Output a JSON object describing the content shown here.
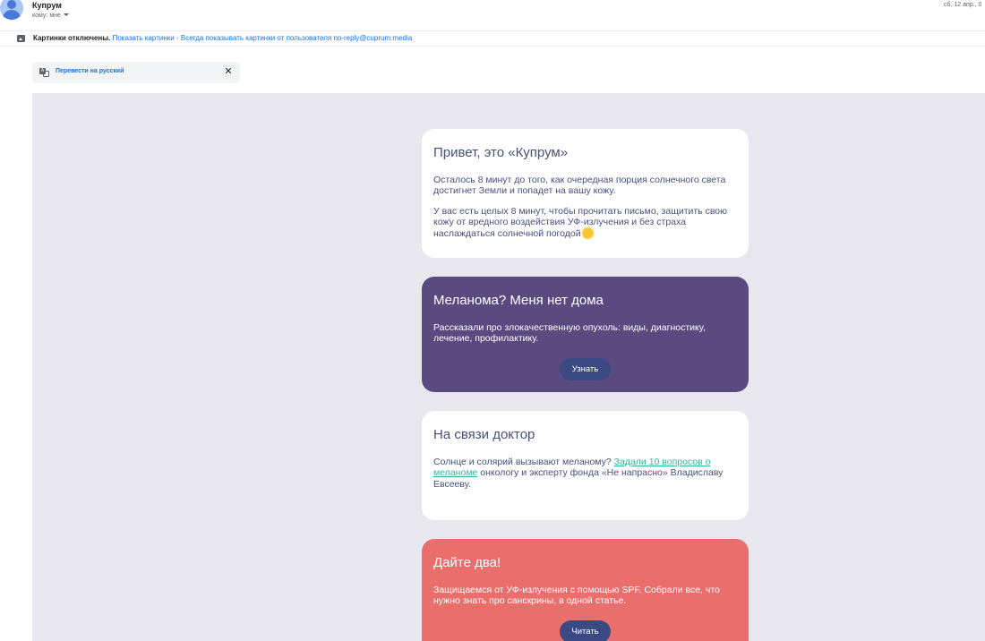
{
  "header": {
    "sender": "Купрум",
    "recipient": "кому: мне",
    "date": "сб, 12 апр., 0"
  },
  "images_bar": {
    "notice": "Картинки отключены.",
    "show_link": "Показать картинки",
    "separator": "-",
    "always_show_link": "Всегда показывать картинки от пользователя no-reply@cuprum.media"
  },
  "translate_bar": {
    "label": "Перевести на русский",
    "close": "✕"
  },
  "cards": {
    "intro": {
      "title": "Привет, это «Купрум»",
      "p1": "Осталось 8 минут до того, как очередная порция солнечного света достигнет Земли и попадет на вашу кожу.",
      "p2": "У вас есть целых 8 минут, чтобы прочитать письмо, защитить свою кожу от вредного воздействия УФ-излучения и без страха наслаждаться солнечной погодой"
    },
    "melanoma": {
      "title": "Меланома? Меня нет дома",
      "text": "Рассказали про злокачественную опухоль: виды, диагностику, лечение, профилактику.",
      "button": "Узнать"
    },
    "doctor": {
      "title": "На связи доктор",
      "text_before": "Солнце и солярий вызывают меланому? ",
      "link": "Задали 10 вопросов о меланоме",
      "text_after": " онкологу и эксперту фонда «Не напрасно» Владиславу Евсееву."
    },
    "spf": {
      "title": "Дайте два!",
      "text": "Защищаемся от УФ-излучения с помощью SPF. Собрали все, что нужно знать про санскрины, в одной статье.",
      "button": "Читать"
    }
  },
  "colors": {
    "canvas": "#e9e7ee",
    "purple_card": "#594a80",
    "coral_card": "#ea6f6c",
    "button": "#3b4a82",
    "link": "#1a73e8"
  }
}
